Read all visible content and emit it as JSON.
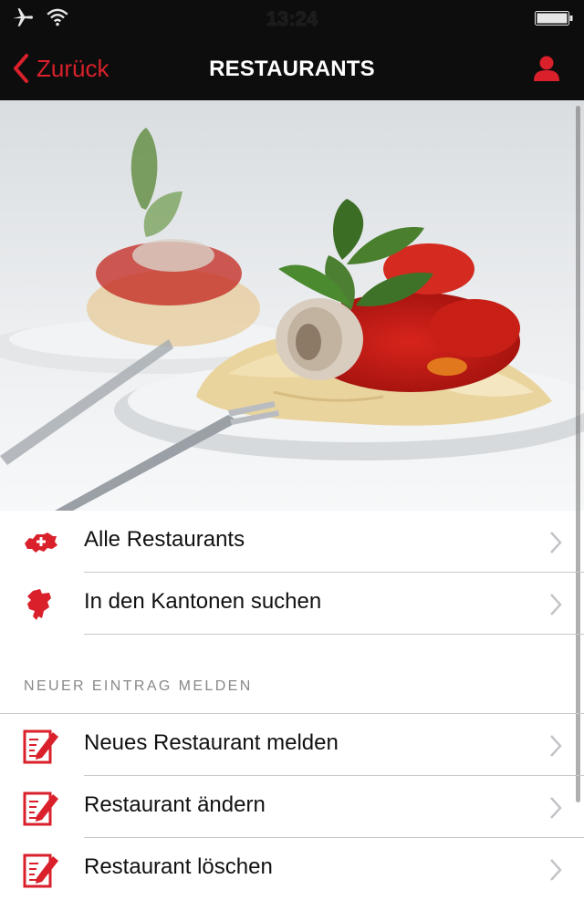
{
  "status_bar": {
    "time": "13:24",
    "icons": [
      "airplane-icon",
      "wifi-icon",
      "battery-icon"
    ]
  },
  "nav": {
    "back_label": "Zurück",
    "title": "RESTAURANTS",
    "profile_icon": "person-icon"
  },
  "hero_image": {
    "subject": "pasta-dish-photo"
  },
  "list_main": [
    {
      "label": "Alle Restaurants",
      "icon": "switzerland-map-icon"
    },
    {
      "label": "In den Kantonen suchen",
      "icon": "canton-map-icon"
    }
  ],
  "section": {
    "header": "NEUER EINTRAG MELDEN"
  },
  "list_report": [
    {
      "label": "Neues Restaurant melden",
      "icon": "edit-document-icon"
    },
    {
      "label": "Restaurant ändern",
      "icon": "edit-document-icon"
    },
    {
      "label": "Restaurant löschen",
      "icon": "edit-document-icon"
    }
  ],
  "colors": {
    "accent": "#d9202b",
    "bar": "#0d0d0d"
  }
}
